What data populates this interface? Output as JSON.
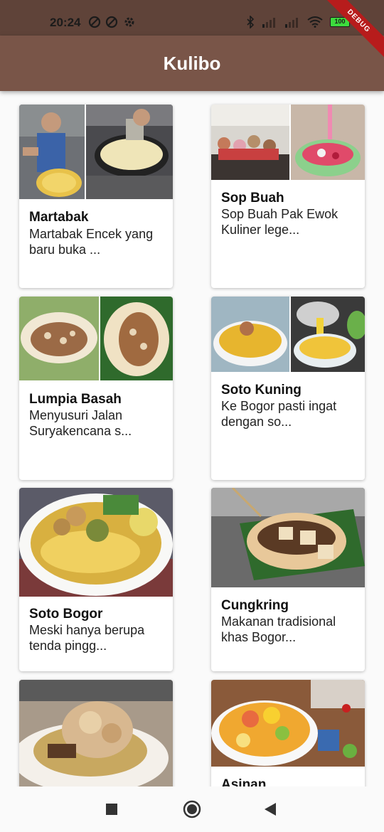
{
  "status": {
    "time": "20:24",
    "battery": "100"
  },
  "debug_label": "DEBUG",
  "app_bar": {
    "title": "Kulibo"
  },
  "cards": [
    {
      "title": "Martabak",
      "desc": "Martabak Encek yang baru buka ..."
    },
    {
      "title": "Sop Buah",
      "desc": "Sop Buah Pak Ewok Kuliner lege..."
    },
    {
      "title": "Lumpia Basah",
      "desc": "Menyusuri Jalan Suryakencana s..."
    },
    {
      "title": "Soto Kuning",
      "desc": "Ke Bogor pasti ingat dengan so..."
    },
    {
      "title": "Soto Bogor",
      "desc": "Meski hanya berupa tenda pingg..."
    },
    {
      "title": "Cungkring",
      "desc": "Makanan tradisional khas Bogor..."
    },
    {
      "title": "",
      "desc": ""
    },
    {
      "title": "Asinan",
      "desc": ""
    }
  ],
  "nav": {
    "recents_icon": "square-icon",
    "home_icon": "circle-icon",
    "back_icon": "triangle-back-icon"
  }
}
